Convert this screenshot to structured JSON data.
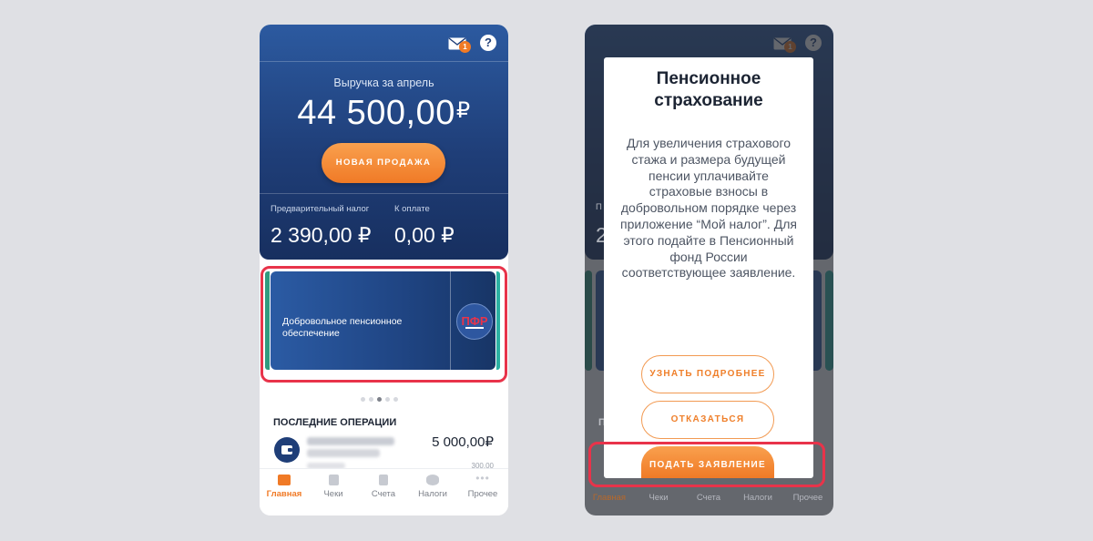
{
  "colors": {
    "accent": "#f07a26",
    "brand_blue": "#1f3e78",
    "highlight_red": "#e8334a"
  },
  "left_screen": {
    "header": {
      "mail_badge_count": "1",
      "help_label": "?",
      "revenue_label": "Выручка за апрель",
      "revenue_amount": "44 500,00",
      "currency_symbol": "₽",
      "new_sale_button": "НОВАЯ ПРОДАЖА",
      "prepaid_tax_label": "Предварительный налог",
      "prepaid_tax_value": "2 390,00 ₽",
      "to_pay_label": "К оплате",
      "to_pay_value": "0,00 ₽"
    },
    "banner": {
      "text": "Добровольное пенсионное обеспечение",
      "logo_icon": "pfr-logo-icon"
    },
    "carousel": {
      "total": 5,
      "active_index": 3
    },
    "operations": {
      "title": "ПОСЛЕДНИЕ ОПЕРАЦИИ",
      "items": [
        {
          "amount": "5 000,00₽",
          "sub_amount": "300,00"
        }
      ]
    },
    "tabs": [
      {
        "label": "Главная",
        "icon": "briefcase-icon",
        "active": true
      },
      {
        "label": "Чеки",
        "icon": "receipt-icon",
        "active": false
      },
      {
        "label": "Счета",
        "icon": "document-icon",
        "active": false
      },
      {
        "label": "Налоги",
        "icon": "coins-icon",
        "active": false
      },
      {
        "label": "Прочее",
        "icon": "more-icon",
        "active": false
      }
    ]
  },
  "right_screen": {
    "modal": {
      "title": "Пенсионное страхование",
      "body": "Для увеличения страхового стажа и размера будущей пенсии уплачивайте страховые взносы в добровольном порядке через приложение “Мой налог”. Для этого подайте в Пенсионный фонд России соответствующее заявление.",
      "learn_more_button": "УЗНАТЬ ПОДРОБНЕЕ",
      "decline_button": "ОТКАЗАТЬСЯ",
      "submit_button": "ПОДАТЬ ЗАЯВЛЕНИЕ"
    },
    "dim_tabs": [
      "Главная",
      "Чеки",
      "Счета",
      "Налоги",
      "Прочее"
    ],
    "dim_visible_text": {
      "ops_prefix": "П",
      "tax_prefix": "П",
      "tax_value_prefix": "2"
    }
  }
}
